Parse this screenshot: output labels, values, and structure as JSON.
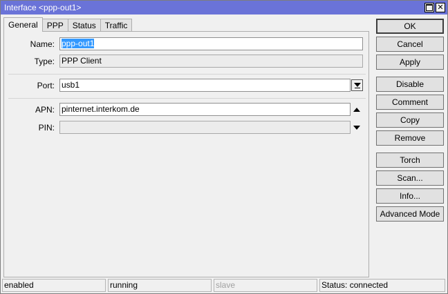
{
  "window": {
    "title": "Interface <ppp-out1>"
  },
  "tabs": [
    {
      "label": "General",
      "active": true
    },
    {
      "label": "PPP",
      "active": false
    },
    {
      "label": "Status",
      "active": false
    },
    {
      "label": "Traffic",
      "active": false
    }
  ],
  "form": {
    "name": {
      "label": "Name:",
      "value": "ppp-out1"
    },
    "type": {
      "label": "Type:",
      "value": "PPP Client"
    },
    "port": {
      "label": "Port:",
      "value": "usb1"
    },
    "apn": {
      "label": "APN:",
      "value": "pinternet.interkom.de"
    },
    "pin": {
      "label": "PIN:",
      "value": ""
    }
  },
  "buttons": {
    "ok": "OK",
    "cancel": "Cancel",
    "apply": "Apply",
    "disable": "Disable",
    "comment": "Comment",
    "copy": "Copy",
    "remove": "Remove",
    "torch": "Torch",
    "scan": "Scan...",
    "info": "Info...",
    "advanced_mode": "Advanced Mode"
  },
  "status_bar": {
    "enabled": "enabled",
    "running": "running",
    "slave": "slave",
    "status": "Status: connected"
  },
  "colors": {
    "titlebar": "#6a73d8",
    "selection": "#3399ff"
  }
}
